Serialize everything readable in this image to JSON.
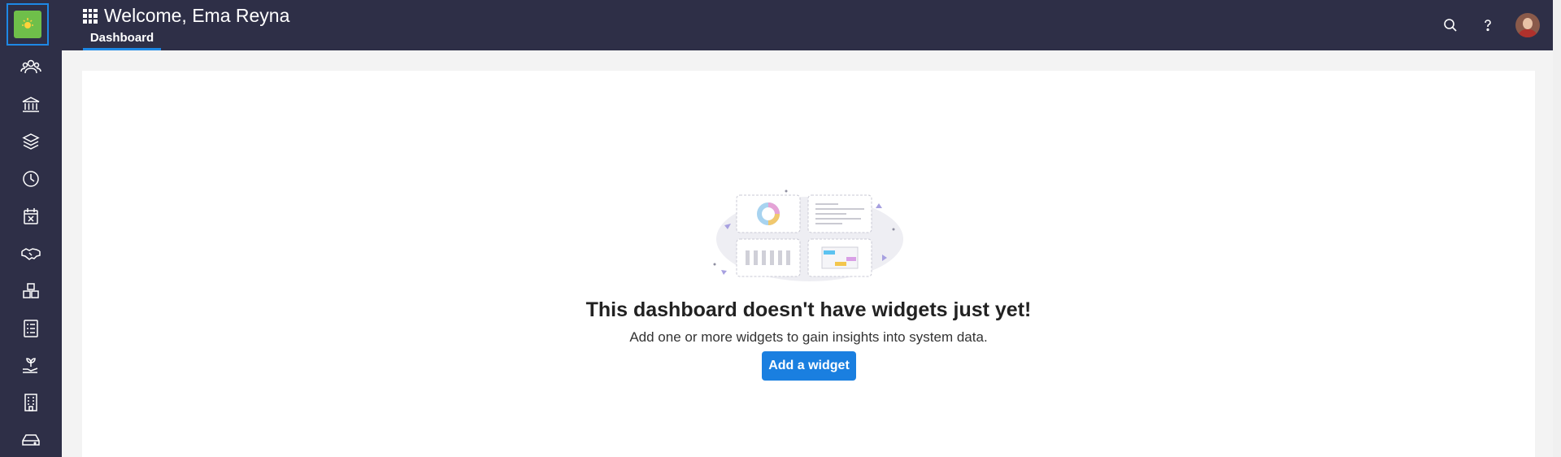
{
  "header": {
    "title": "Welcome, Ema Reyna",
    "tab_dashboard": "Dashboard"
  },
  "rail": {
    "items": [
      "people-icon",
      "bank-icon",
      "layers-icon",
      "clock-icon",
      "calendar-x-icon",
      "handshake-icon",
      "boxes-icon",
      "checklist-icon",
      "plant-hand-icon",
      "building-icon",
      "drive-icon"
    ]
  },
  "top_actions": [
    "search-icon",
    "help-icon",
    "avatar"
  ],
  "empty_state": {
    "title": "This dashboard doesn't have widgets just yet!",
    "subtitle": "Add one or more widgets to gain insights into system data.",
    "button": "Add a widget"
  },
  "colors": {
    "chrome": "#2e2f47",
    "accent": "#1a7fe0",
    "logo_green": "#6fbf4a"
  }
}
